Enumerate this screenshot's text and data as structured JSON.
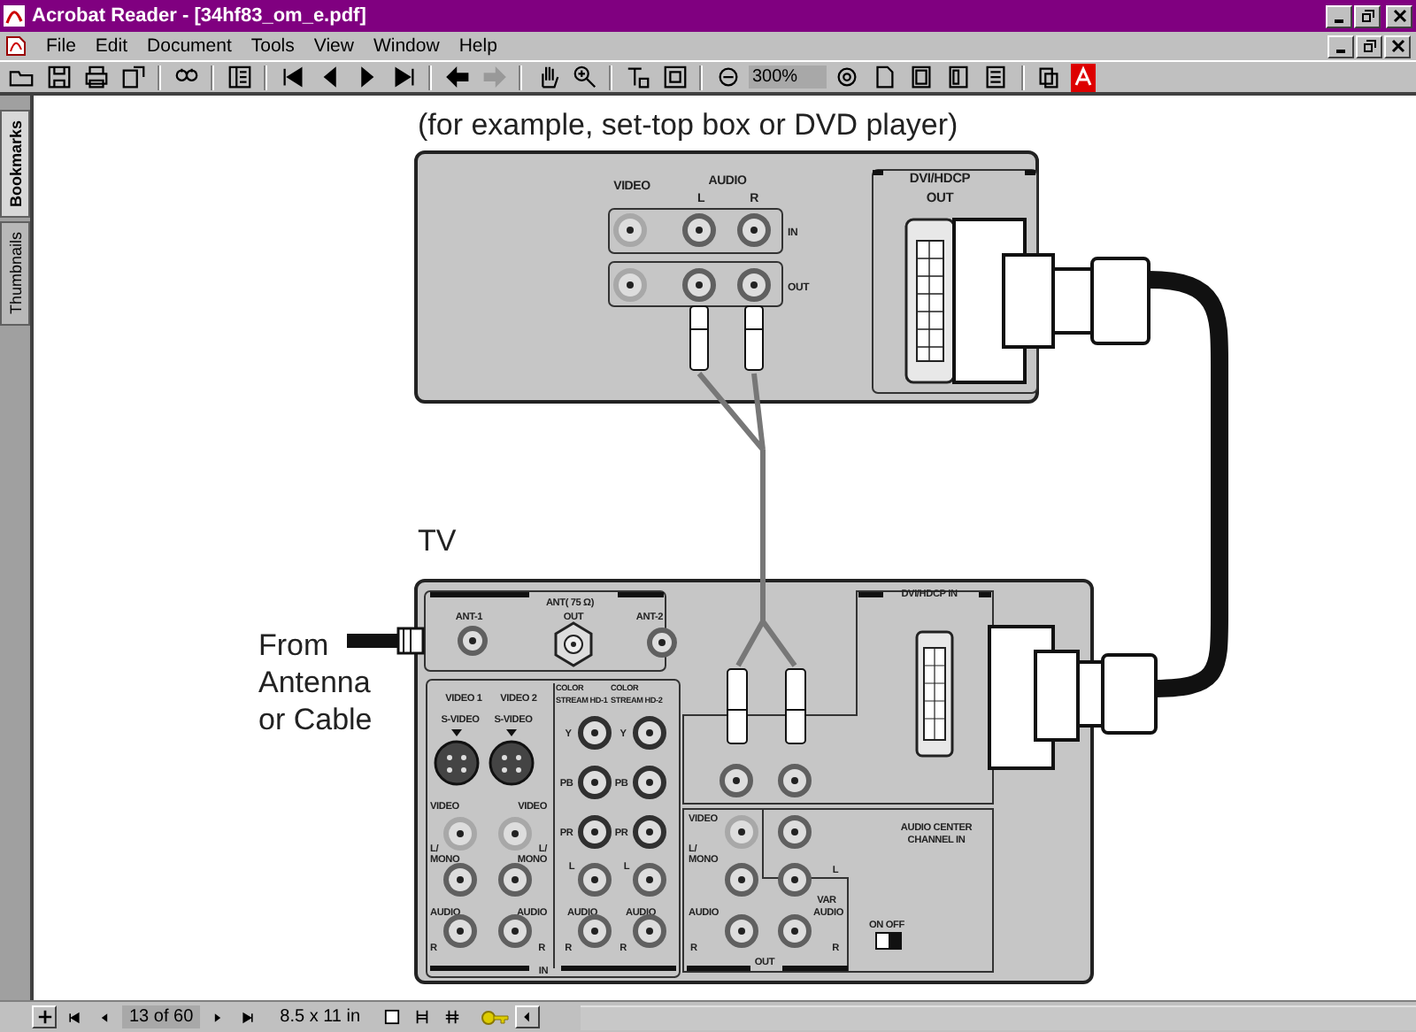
{
  "window": {
    "title": "Acrobat Reader - [34hf83_om_e.pdf]"
  },
  "menu": [
    "File",
    "Edit",
    "Document",
    "Tools",
    "View",
    "Window",
    "Help"
  ],
  "toolbar": {
    "zoom": "300%"
  },
  "side_tabs": [
    {
      "label": "Bookmarks",
      "selected": true
    },
    {
      "label": "Thumbnails",
      "selected": false
    }
  ],
  "page": {
    "caption": "(for example, set-top box or DVD player)",
    "tv_label": "TV",
    "source_label": [
      "From",
      "Antenna",
      "or Cable"
    ],
    "source_device_labels": [
      "VIDEO",
      "AUDIO",
      "L",
      "R",
      "IN",
      "OUT",
      "DVI/HDCP",
      "OUT"
    ],
    "tv_labels": [
      "ANT( 75 Ω)",
      "ANT-1",
      "OUT",
      "ANT-2",
      "VIDEO 1",
      "VIDEO 2",
      "S-VIDEO",
      "S-VIDEO",
      "COLOR",
      "STREAM HD-1",
      "COLOR",
      "STREAM HD-2",
      "Y",
      "Y",
      "PB",
      "PB",
      "PR",
      "PR",
      "VIDEO",
      "VIDEO",
      "L/",
      "MONO",
      "L/",
      "MONO",
      "AUDIO",
      "AUDIO",
      "R",
      "R",
      "L",
      "L",
      "AUDIO",
      "AUDIO",
      "R",
      "R",
      "IN",
      "DVI/HDCP IN",
      "VIDEO",
      "L/",
      "MONO",
      "AUDIO",
      "R",
      "OUT",
      "AUDIO CENTER",
      "CHANNEL IN",
      "L",
      "VAR",
      "AUDIO",
      "R",
      "ON OFF"
    ]
  },
  "status_bar": {
    "page": "13 of 60",
    "size": "8.5 x 11 in"
  }
}
